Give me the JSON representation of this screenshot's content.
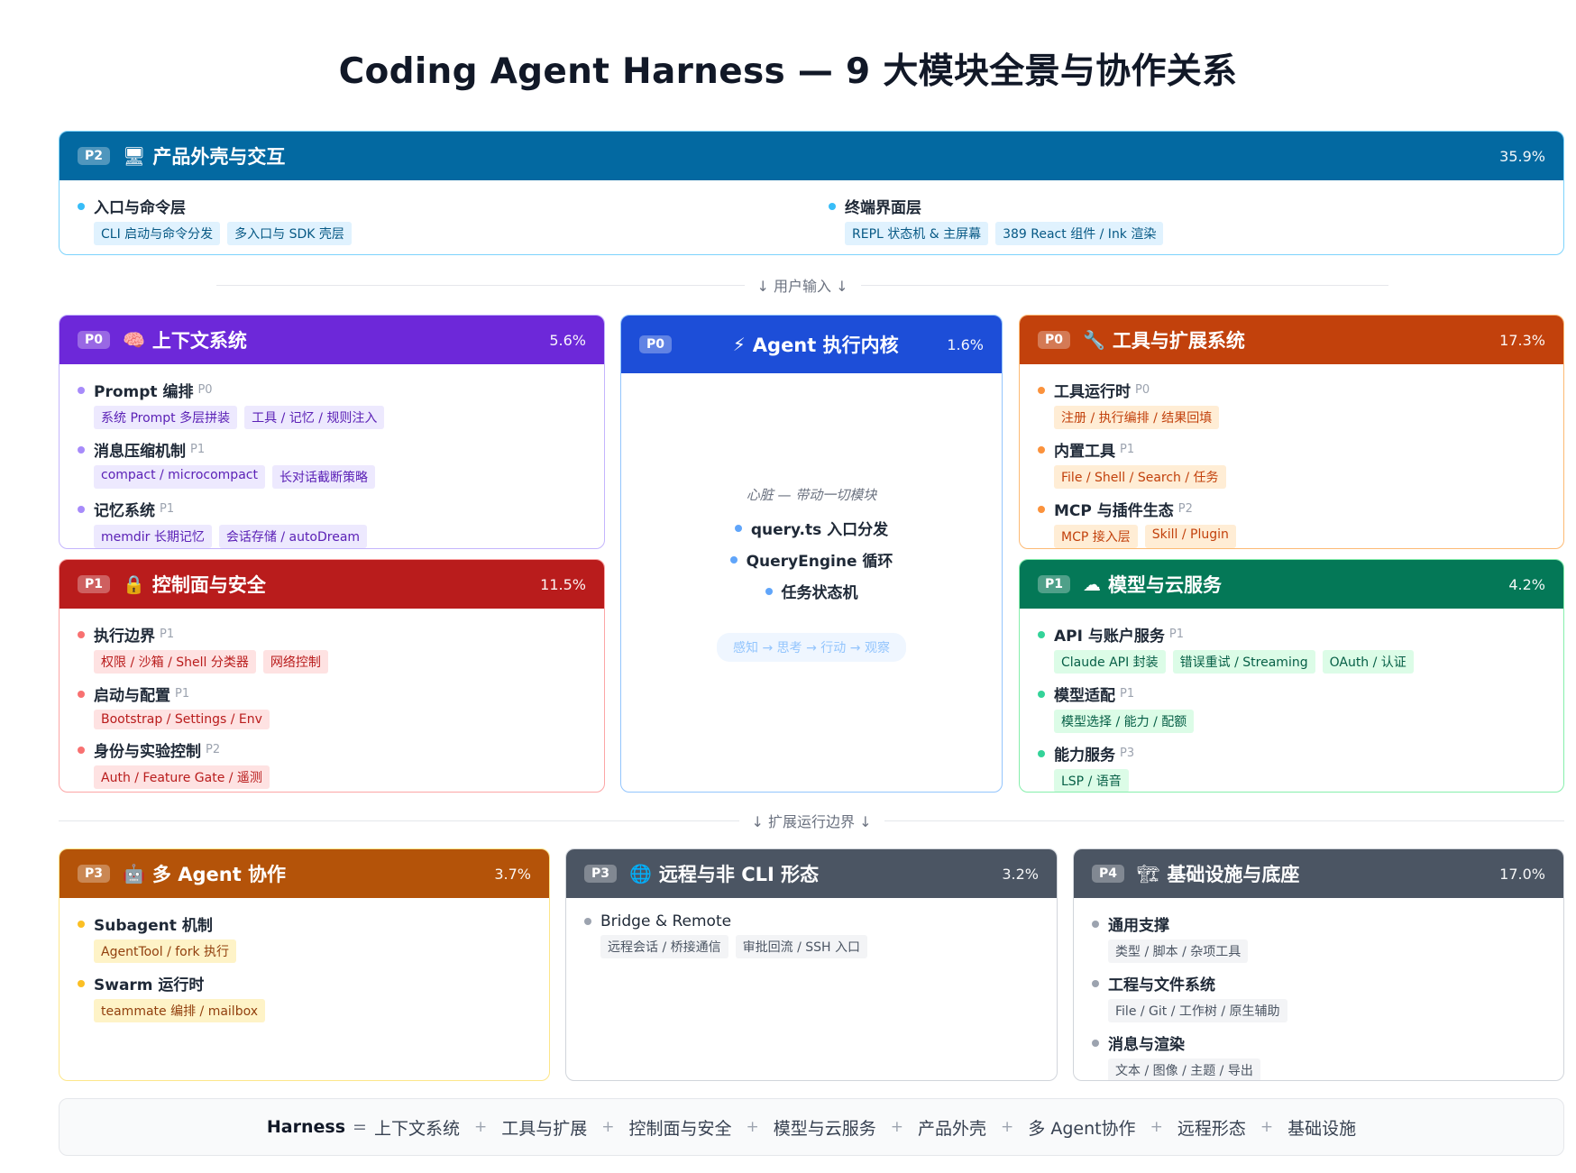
{
  "title": "Coding Agent Harness — 9 大模块全景与协作关系",
  "dividers": {
    "user_input": "↓ 用户输入 ↓",
    "extend": "↓ 扩展运行边界 ↓"
  },
  "product": {
    "badge": "P2",
    "icon": "🖥",
    "title": "产品外壳与交互",
    "pct": "35.9%",
    "columns": [
      {
        "name": "入口与命令层",
        "tags": [
          "CLI 启动与命令分发",
          "多入口与 SDK 壳层"
        ]
      },
      {
        "name": "终端界面层",
        "tags": [
          "REPL 状态机 & 主屏幕",
          "389 React 组件 / Ink 渲染"
        ]
      }
    ]
  },
  "context": {
    "badge": "P0",
    "icon": "🧠",
    "title": "上下文系统",
    "pct": "5.6%",
    "items": [
      {
        "name": "Prompt 编排",
        "level": "P0",
        "tags": [
          "系统 Prompt 多层拼装",
          "工具 / 记忆 / 规则注入"
        ]
      },
      {
        "name": "消息压缩机制",
        "level": "P1",
        "tags": [
          "compact / microcompact",
          "长对话截断策略"
        ]
      },
      {
        "name": "记忆系统",
        "level": "P1",
        "tags": [
          "memdir 长期记忆",
          "会话存储 / autoDream"
        ]
      }
    ]
  },
  "core": {
    "badge": "P0",
    "icon": "⚡",
    "title": "Agent 执行内核",
    "pct": "1.6%",
    "subtitle": "心脏 — 带动一切模块",
    "items": [
      "query.ts 入口分发",
      "QueryEngine 循环",
      "任务状态机"
    ],
    "loop": "感知 → 思考 → 行动 → 观察"
  },
  "tools": {
    "badge": "P0",
    "icon": "🔧",
    "title": "工具与扩展系统",
    "pct": "17.3%",
    "items": [
      {
        "name": "工具运行时",
        "level": "P0",
        "tags": [
          "注册 / 执行编排 / 结果回填"
        ]
      },
      {
        "name": "内置工具",
        "level": "P1",
        "tags": [
          "File / Shell / Search / 任务"
        ]
      },
      {
        "name": "MCP 与插件生态",
        "level": "P2",
        "tags": [
          "MCP 接入层",
          "Skill / Plugin"
        ]
      }
    ]
  },
  "control": {
    "badge": "P1",
    "icon": "🔒",
    "title": "控制面与安全",
    "pct": "11.5%",
    "items": [
      {
        "name": "执行边界",
        "level": "P1",
        "tags": [
          "权限 / 沙箱 / Shell 分类器",
          "网络控制"
        ]
      },
      {
        "name": "启动与配置",
        "level": "P1",
        "tags": [
          "Bootstrap / Settings / Env"
        ]
      },
      {
        "name": "身份与实验控制",
        "level": "P2",
        "tags": [
          "Auth / Feature Gate / 遥测"
        ]
      }
    ]
  },
  "model": {
    "badge": "P1",
    "icon": "☁",
    "title": "模型与云服务",
    "pct": "4.2%",
    "items": [
      {
        "name": "API 与账户服务",
        "level": "P1",
        "tags": [
          "Claude API 封装",
          "错误重试 / Streaming",
          "OAuth / 认证"
        ]
      },
      {
        "name": "模型适配",
        "level": "P1",
        "tags": [
          "模型选择 / 能力 / 配额"
        ]
      },
      {
        "name": "能力服务",
        "level": "P3",
        "tags": [
          "LSP / 语音"
        ]
      }
    ]
  },
  "multi": {
    "badge": "P3",
    "icon": "🤖",
    "title": "多 Agent 协作",
    "pct": "3.7%",
    "items": [
      {
        "name": "Subagent 机制",
        "level": "",
        "tags": [
          "AgentTool / fork 执行"
        ]
      },
      {
        "name": "Swarm 运行时",
        "level": "",
        "tags": [
          "teammate 编排 / mailbox"
        ]
      }
    ]
  },
  "remote": {
    "badge": "P3",
    "icon": "🌐",
    "title": "远程与非 CLI 形态",
    "pct": "3.2%",
    "items": [
      {
        "name": "Bridge & Remote",
        "level": "",
        "tags": [
          "远程会话 / 桥接通信",
          "审批回流 / SSH 入口"
        ]
      }
    ]
  },
  "infra": {
    "badge": "P4",
    "icon": "🏗",
    "title": "基础设施与底座",
    "pct": "17.0%",
    "items": [
      {
        "name": "通用支撑",
        "level": "",
        "tags": [
          "类型 / 脚本 / 杂项工具"
        ]
      },
      {
        "name": "工程与文件系统",
        "level": "",
        "tags": [
          "File / Git / 工作树 / 原生辅助"
        ]
      },
      {
        "name": "消息与渲染",
        "level": "",
        "tags": [
          "文本 / 图像 / 主题 / 导出"
        ]
      }
    ]
  },
  "formula": {
    "lhs": "Harness",
    "eq": "=",
    "op": "+",
    "terms": [
      "上下文系统",
      "工具与扩展",
      "控制面与安全",
      "模型与云服务",
      "产品外壳",
      "多 Agent协作",
      "远程形态",
      "基础设施"
    ]
  }
}
